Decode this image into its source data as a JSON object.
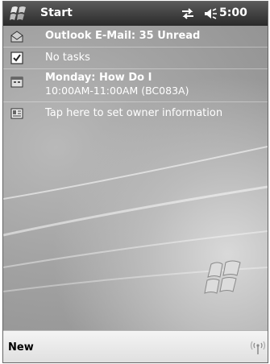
{
  "titlebar": {
    "title": "Start",
    "time": "5:00",
    "icons": [
      "start-flag-icon",
      "sync-icon",
      "speaker-icon"
    ]
  },
  "today": {
    "items": [
      {
        "icon": "envelope-icon",
        "text": "Outlook E-Mail: 35 Unread"
      },
      {
        "icon": "checkbox-icon",
        "text": "No tasks"
      },
      {
        "icon": "calendar-icon",
        "title": "Monday: How Do I",
        "subtitle": "10:00AM-11:00AM (BC083A)"
      },
      {
        "icon": "owner-card-icon",
        "text": "Tap here to set owner information"
      }
    ]
  },
  "menubar": {
    "left_label": "New",
    "right_icon": "antenna-icon"
  }
}
